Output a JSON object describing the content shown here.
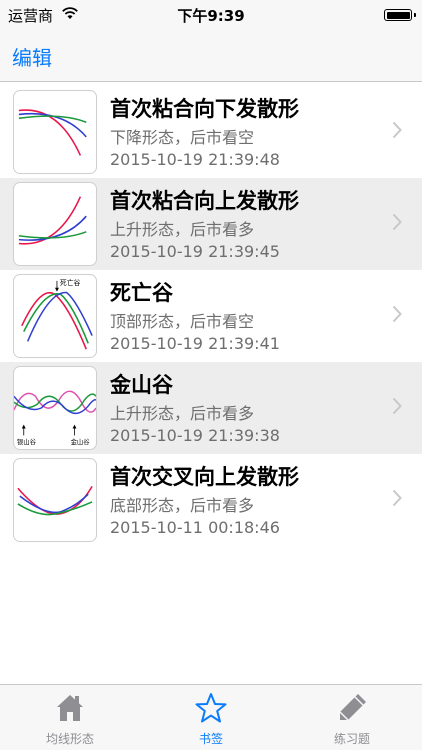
{
  "status": {
    "carrier": "运营商",
    "time": "下午9:39"
  },
  "nav": {
    "edit_label": "编辑"
  },
  "items": [
    {
      "title": "首次粘合向下发散形",
      "subtitle": "下降形态，后市看空",
      "date": "2015-10-19 21:39:48"
    },
    {
      "title": "首次粘合向上发散形",
      "subtitle": "上升形态，后市看多",
      "date": "2015-10-19 21:39:45"
    },
    {
      "title": "死亡谷",
      "subtitle": "顶部形态，后市看空",
      "date": "2015-10-19 21:39:41",
      "thumb_label": "死亡谷"
    },
    {
      "title": "金山谷",
      "subtitle": "上升形态，后市看多",
      "date": "2015-10-19 21:39:38",
      "thumb_labels": [
        "银山谷",
        "金山谷"
      ]
    },
    {
      "title": "首次交叉向上发散形",
      "subtitle": "底部形态，后市看多",
      "date": "2015-10-11 00:18:46"
    }
  ],
  "tabs": [
    {
      "label": "均线形态",
      "icon": "house-icon"
    },
    {
      "label": "书签",
      "icon": "star-icon",
      "active": true
    },
    {
      "label": "练习题",
      "icon": "pencil-icon"
    }
  ],
  "colors": {
    "accent": "#0a7cfb",
    "line_red": "#e8174a",
    "line_blue": "#2f3fd0",
    "line_green": "#1a9a3a",
    "line_pink": "#e04fb0"
  }
}
